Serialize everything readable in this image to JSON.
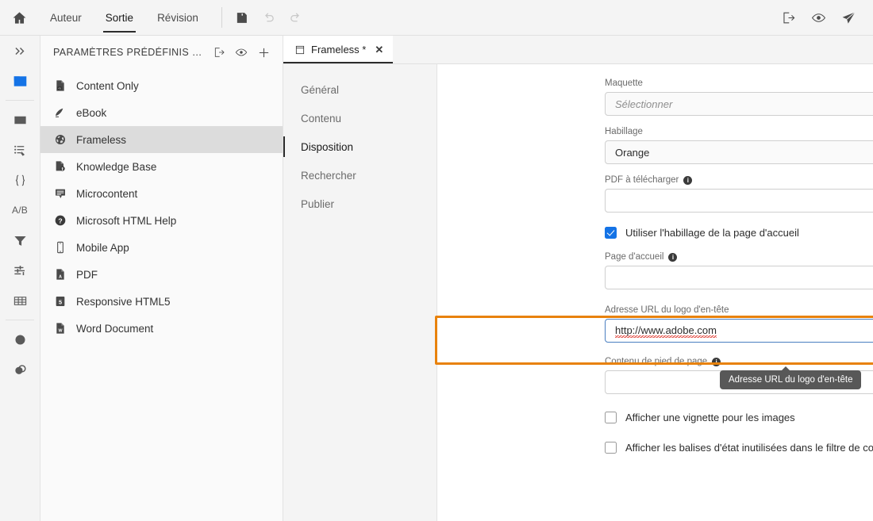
{
  "topbar": {
    "home_icon": "home-icon",
    "menus": [
      {
        "label": "Auteur",
        "active": false
      },
      {
        "label": "Sortie",
        "active": true
      },
      {
        "label": "Révision",
        "active": false
      }
    ],
    "tools": [
      {
        "name": "save-icon",
        "enabled": true
      },
      {
        "name": "undo-icon",
        "enabled": false
      },
      {
        "name": "redo-icon",
        "enabled": false
      }
    ],
    "right_tools": [
      {
        "name": "export-icon"
      },
      {
        "name": "preview-eye-icon"
      },
      {
        "name": "publish-send-icon"
      }
    ]
  },
  "rail": {
    "items": [
      {
        "name": "expand-chevrons-icon",
        "label": ""
      },
      {
        "name": "output-presets-icon",
        "label": "",
        "active": true
      },
      {
        "name": "content-layout-icon",
        "label": ""
      },
      {
        "name": "tags-list-icon",
        "label": ""
      },
      {
        "name": "variables-braces-icon",
        "label": ""
      },
      {
        "name": "ab-testing-icon",
        "label": "A/B"
      },
      {
        "name": "filter-funnel-icon",
        "label": ""
      },
      {
        "name": "conditions-icon",
        "label": ""
      },
      {
        "name": "table-grid-icon",
        "label": ""
      },
      {
        "name": "snippet-circle-icon",
        "label": ""
      },
      {
        "name": "styles-overlap-icon",
        "label": ""
      }
    ]
  },
  "presets": {
    "title": "PARAMÈTRES PRÉDÉFINIS D...",
    "header_actions": [
      {
        "name": "export-preset-icon"
      },
      {
        "name": "preview-preset-icon"
      },
      {
        "name": "add-preset-icon"
      }
    ],
    "items": [
      {
        "label": "Content Only",
        "icon": "content-only-icon",
        "selected": false
      },
      {
        "label": "eBook",
        "icon": "ebook-icon",
        "selected": false
      },
      {
        "label": "Frameless",
        "icon": "globe-icon",
        "selected": true
      },
      {
        "label": "Knowledge Base",
        "icon": "knowledge-base-icon",
        "selected": false
      },
      {
        "label": "Microcontent",
        "icon": "microcontent-icon",
        "selected": false
      },
      {
        "label": "Microsoft HTML Help",
        "icon": "help-question-icon",
        "selected": false
      },
      {
        "label": "Mobile App",
        "icon": "mobile-phone-icon",
        "selected": false
      },
      {
        "label": "PDF",
        "icon": "pdf-icon",
        "selected": false
      },
      {
        "label": "Responsive HTML5",
        "icon": "html5-icon",
        "selected": false
      },
      {
        "label": "Word Document",
        "icon": "word-icon",
        "selected": false
      }
    ]
  },
  "doc_tab": {
    "label": "Frameless *",
    "close": "✕",
    "icon": "document-window-icon"
  },
  "subnav": {
    "items": [
      {
        "label": "Général",
        "active": false
      },
      {
        "label": "Contenu",
        "active": false
      },
      {
        "label": "Disposition",
        "active": true
      },
      {
        "label": "Rechercher",
        "active": false
      },
      {
        "label": "Publier",
        "active": false
      }
    ]
  },
  "form": {
    "maquette": {
      "label": "Maquette",
      "value": "Sélectionner",
      "is_placeholder": true
    },
    "habillage": {
      "label": "Habillage",
      "value": "Orange",
      "browse_icon": "browse-folder-search-icon",
      "edit_icon": "pencil-edit-icon"
    },
    "pdf_download": {
      "label": "PDF à télécharger",
      "value": "",
      "info_icon": "info-icon",
      "browse_icon": "browse-folder-search-icon"
    },
    "use_home_skin": {
      "label": "Utiliser l'habillage de la page d'accueil",
      "checked": true
    },
    "home_page": {
      "label": "Page d'accueil",
      "value": "",
      "info_icon": "info-icon",
      "browse_icon": "browse-folder-search-icon"
    },
    "header_logo_url": {
      "label": "Adresse URL du logo d'en-tête",
      "value": "http://www.adobe.com",
      "browse_icon": "browse-folder-search-icon",
      "highlighted": true,
      "highlight_color": "#e8820c"
    },
    "footer_content": {
      "label": "Contenu de pied de page",
      "value": "",
      "info_icon": "info-icon",
      "browse_icon": "browse-folder-search-icon"
    },
    "show_thumbnail": {
      "label": "Afficher une vignette pour les images",
      "checked": false
    },
    "show_unused_tags": {
      "label": "Afficher les balises d'état inutilisées dans le filtre de contenu dynamique",
      "checked": false
    }
  },
  "tooltip": {
    "text": "Adresse URL du logo d'en-tête"
  },
  "colors": {
    "accent_blue": "#1473e6",
    "highlight_orange": "#e8820c",
    "tooltip_bg": "#585858",
    "panel_bg": "#f4f4f4",
    "selected_row": "#dcdcdc"
  }
}
